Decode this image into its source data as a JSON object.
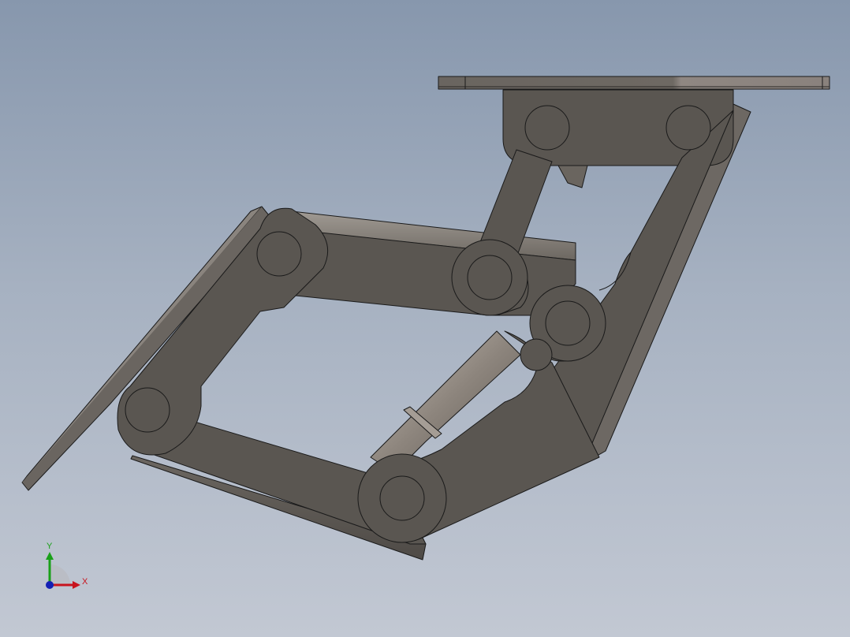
{
  "viewport": {
    "background_top": "#8797ad",
    "background_bottom": "#c2c8d3"
  },
  "model": {
    "part_color": "#5a5651",
    "part_shade": "#4a4743",
    "part_highlight": "#8a8580",
    "edge_color": "#1a1a1a",
    "plate_color": "#6e6963"
  },
  "triad": {
    "x_label": "X",
    "y_label": "Y",
    "x_color": "#c8141e",
    "y_color": "#19a019",
    "z_color": "#1420b4"
  }
}
